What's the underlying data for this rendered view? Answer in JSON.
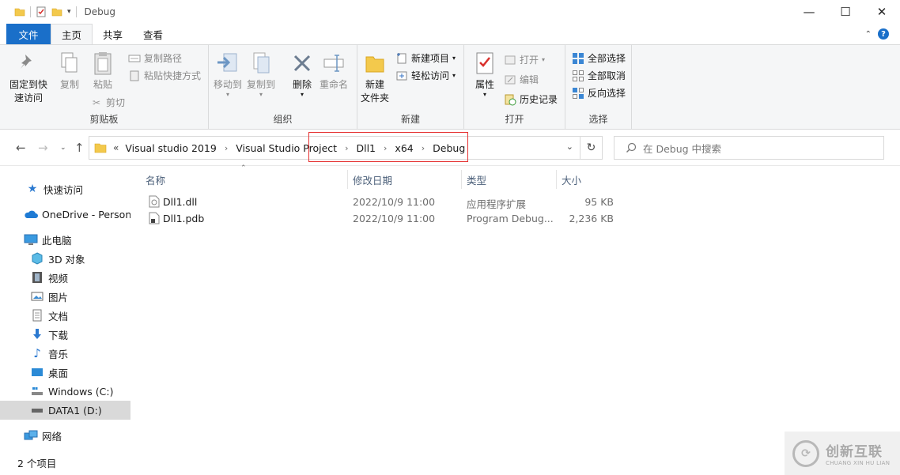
{
  "window": {
    "title": "Debug",
    "minimize": "—",
    "maximize": "☐",
    "close": "✕"
  },
  "tabs": {
    "file": "文件",
    "home": "主页",
    "share": "共享",
    "view": "查看"
  },
  "ribbon": {
    "clipboard": {
      "label": "剪贴板",
      "pin_line1": "固定到快",
      "pin_line2": "速访问",
      "copy": "复制",
      "paste": "粘贴",
      "copy_path": "复制路径",
      "paste_shortcut": "粘贴快捷方式",
      "cut": "剪切"
    },
    "organize": {
      "label": "组织",
      "move_to": "移动到",
      "copy_to": "复制到",
      "delete": "删除",
      "rename": "重命名"
    },
    "new": {
      "label": "新建",
      "new_folder_line1": "新建",
      "new_folder_line2": "文件夹",
      "new_item": "新建项目",
      "easy_access": "轻松访问"
    },
    "open": {
      "label": "打开",
      "properties": "属性",
      "open": "打开",
      "edit": "编辑",
      "history": "历史记录"
    },
    "select": {
      "label": "选择",
      "select_all": "全部选择",
      "select_none": "全部取消",
      "invert": "反向选择"
    }
  },
  "address": {
    "overflow": "«",
    "crumbs": [
      "Visual studio 2019",
      "Visual Studio Project",
      "Dll1",
      "x64",
      "Debug"
    ],
    "search_placeholder": "在 Debug 中搜索"
  },
  "nav": {
    "quick_access": "快速访问",
    "onedrive": "OneDrive - Persona",
    "this_pc": "此电脑",
    "objects3d": "3D 对象",
    "videos": "视频",
    "pictures": "图片",
    "documents": "文档",
    "downloads": "下载",
    "music": "音乐",
    "desktop": "桌面",
    "windows_c": "Windows (C:)",
    "data1_d": "DATA1 (D:)",
    "network": "网络"
  },
  "columns": {
    "name": "名称",
    "modified": "修改日期",
    "type": "类型",
    "size": "大小"
  },
  "files": [
    {
      "name": "Dll1.dll",
      "modified": "2022/10/9 11:00",
      "type": "应用程序扩展",
      "size": "95 KB"
    },
    {
      "name": "Dll1.pdb",
      "modified": "2022/10/9 11:00",
      "type": "Program Debug...",
      "size": "2,236 KB"
    }
  ],
  "status": {
    "count": "2 个项目"
  },
  "watermark": {
    "brand": "创新互联",
    "sub": "CHUANG XIN HU LIAN"
  }
}
